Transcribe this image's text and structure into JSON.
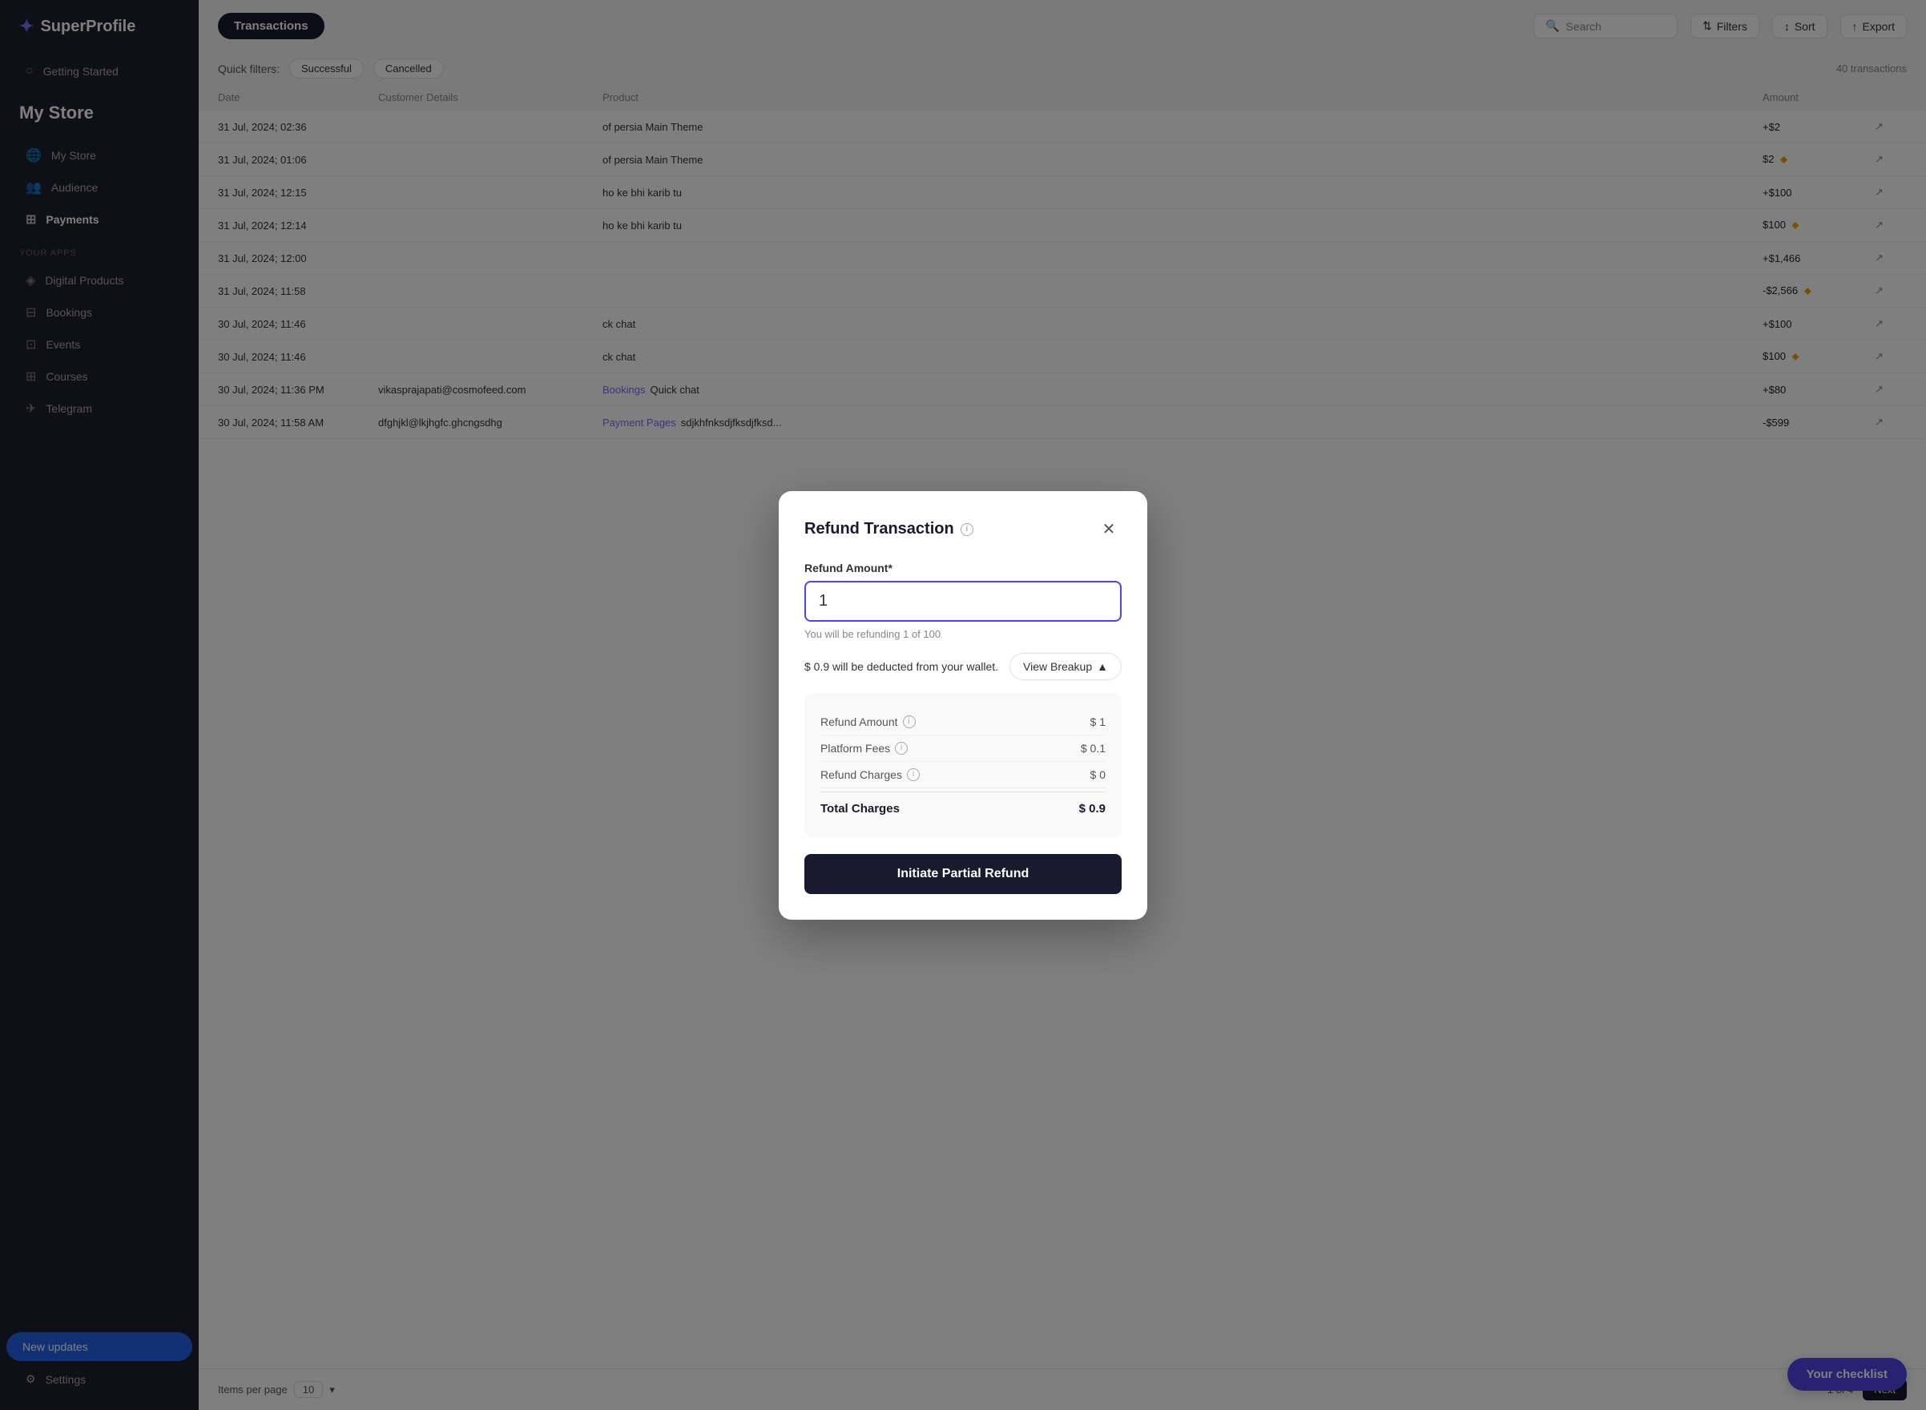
{
  "app": {
    "name": "SuperProfile",
    "logo_icon": "✦"
  },
  "sidebar": {
    "store_name": "My Store",
    "nav_items": [
      {
        "id": "getting-started",
        "label": "Getting Started",
        "icon": "○"
      },
      {
        "id": "my-store",
        "label": "My Store",
        "icon": "🌐"
      },
      {
        "id": "audience",
        "label": "Audience",
        "icon": "👥"
      },
      {
        "id": "payments",
        "label": "Payments",
        "icon": "⊞",
        "active": true
      }
    ],
    "section_label": "YOUR APPS",
    "apps": [
      {
        "id": "digital-products",
        "label": "Digital Products",
        "icon": "◈"
      },
      {
        "id": "bookings",
        "label": "Bookings",
        "icon": "⊟"
      },
      {
        "id": "events",
        "label": "Events",
        "icon": "⊡"
      },
      {
        "id": "courses",
        "label": "Courses",
        "icon": "⊞"
      },
      {
        "id": "telegram",
        "label": "Telegram",
        "icon": "✈"
      }
    ],
    "bottom": {
      "new_updates_label": "New updates",
      "settings_label": "Settings"
    }
  },
  "topbar": {
    "title": "Transactions",
    "search_placeholder": "Search",
    "filters_label": "Filters",
    "sort_label": "Sort",
    "export_label": "Export"
  },
  "quick_filters": {
    "label": "Quick filters:",
    "options": [
      "Successful",
      "Cancelled"
    ],
    "count": "40 transactions"
  },
  "table": {
    "headers": [
      "Date",
      "Customer Details",
      "Product",
      "Amount",
      ""
    ],
    "rows": [
      {
        "date": "31 Jul, 2024; 02:36",
        "customer": "",
        "product": "of persia Main Theme",
        "amount": "+$2",
        "warning": false
      },
      {
        "date": "31 Jul, 2024; 01:06",
        "customer": "",
        "product": "of persia Main Theme",
        "amount": "$2",
        "warning": true
      },
      {
        "date": "31 Jul, 2024; 12:15",
        "customer": "",
        "product": "ho ke bhi karib tu",
        "amount": "+$100",
        "warning": false
      },
      {
        "date": "31 Jul, 2024; 12:14",
        "customer": "",
        "product": "ho ke bhi karib tu",
        "amount": "$100",
        "warning": true
      },
      {
        "date": "31 Jul, 2024; 12:00",
        "customer": "",
        "product": "",
        "amount": "+$1,466",
        "warning": false
      },
      {
        "date": "31 Jul, 2024; 11:58",
        "customer": "",
        "product": "",
        "amount": "-$2,566",
        "warning": true
      },
      {
        "date": "30 Jul, 2024; 11:46",
        "customer": "",
        "product": "ck chat",
        "amount": "+$100",
        "warning": false
      },
      {
        "date": "30 Jul, 2024; 11:46",
        "customer": "",
        "product": "ck chat",
        "amount": "$100",
        "warning": true
      },
      {
        "date": "30 Jul, 2024; 11:36 PM",
        "customer": "vikasprajapati@cosmofeed.com",
        "product_type": "Bookings",
        "product": "Quick chat",
        "amount": "+$80",
        "warning": false
      },
      {
        "date": "30 Jul, 2024; 11:58 AM",
        "customer": "dfghjkl@lkjhgfc.ghcngsdhg",
        "product_type": "Payment Pages",
        "product": "sdjkhfnksdjfksdjfksd...",
        "amount": "-$599",
        "warning": false
      }
    ]
  },
  "pagination": {
    "items_per_page_label": "Items per page",
    "items_per_page_value": "10",
    "page_info": "1 of 4",
    "prev_label": "Your checklist",
    "next_label": "Next"
  },
  "modal": {
    "title": "Refund Transaction",
    "label": "Refund Amount*",
    "input_value": "1",
    "hint": "You will be refunding 1 of 100",
    "wallet_text": "$ 0.9 will be deducted from your wallet.",
    "view_breakup_label": "View Breakup",
    "breakup_open": true,
    "breakup_items": [
      {
        "label": "Refund Amount",
        "value": "$ 1",
        "has_info": true
      },
      {
        "label": "Platform Fees",
        "value": "$ 0.1",
        "has_info": true
      },
      {
        "label": "Refund Charges",
        "value": "$ 0",
        "has_info": true
      }
    ],
    "total_label": "Total Charges",
    "total_value": "$ 0.9",
    "cta_label": "Initiate Partial Refund"
  },
  "checklist": {
    "label": "Your checklist"
  }
}
